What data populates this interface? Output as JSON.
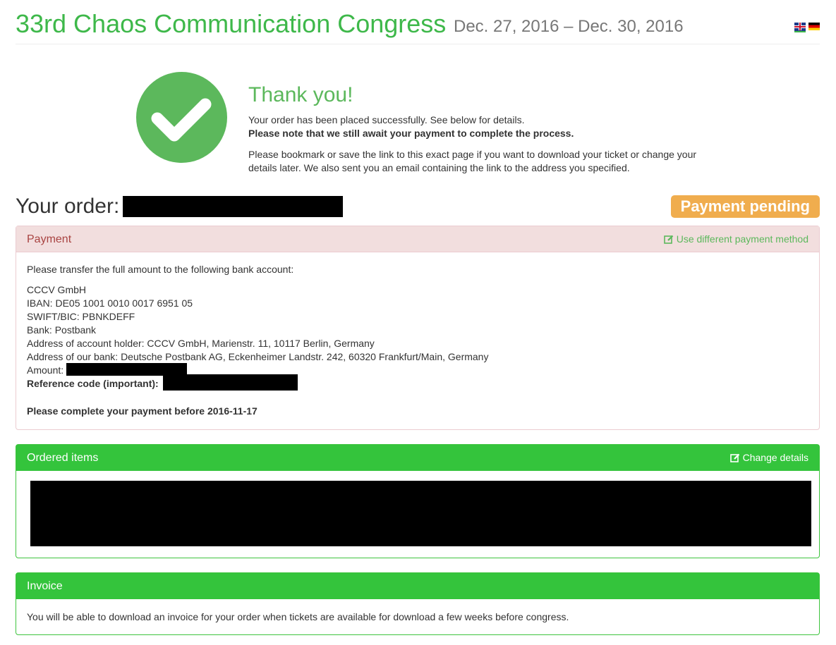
{
  "header": {
    "title": "33rd Chaos Communication Congress",
    "dates": "Dec. 27, 2016 – Dec. 30, 2016",
    "languages": [
      "en-flag-icon",
      "de-flag-icon"
    ]
  },
  "thanks": {
    "title": "Thank you!",
    "line1": "Your order has been placed successfully. See below for details.",
    "line2": "Please note that we still await your payment to complete the process.",
    "paragraph": "Please bookmark or save the link to this exact page if you want to download your ticket or change your details later. We also sent you an email containing the link to the address you specified.",
    "icon": "checkmark-icon"
  },
  "order": {
    "label": "Your order:",
    "status": "Payment pending",
    "status_color": "#f0ad4e"
  },
  "payment": {
    "heading": "Payment",
    "action": "Use different payment method",
    "intro": "Please transfer the full amount to the following bank account:",
    "bank": {
      "name": "CCCV GmbH",
      "iban": "IBAN: DE05 1001 0010 0017 6951 05",
      "swift": "SWIFT/BIC: PBNKDEFF",
      "bank": "Bank: Postbank",
      "holder_address": "Address of account holder: CCCV GmbH, Marienstr. 11, 10117 Berlin, Germany",
      "bank_address": "Address of our bank: Deutsche Postbank AG, Eckenheimer Landstr. 242, 60320 Frankfurt/Main, Germany",
      "amount_label": "Amount:",
      "reference_label": "Reference code (important):"
    },
    "deadline": "Please complete your payment before 2016-11-17"
  },
  "items": {
    "heading": "Ordered items",
    "action": "Change details"
  },
  "invoice": {
    "heading": "Invoice",
    "text": "You will be able to download an invoice for your order when tickets are available for download a few weeks before congress."
  },
  "colors": {
    "brand_green": "#3eb84a",
    "success_green": "#34c43c",
    "danger_bg": "#f2dede",
    "warning": "#f0ad4e"
  }
}
